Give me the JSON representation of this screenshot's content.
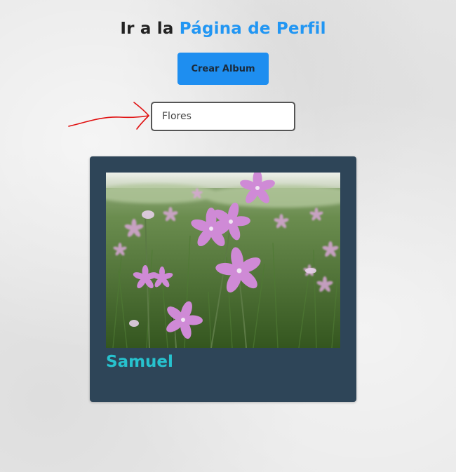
{
  "header": {
    "prefix": "Ir a la",
    "link_text": "Página de Perfil"
  },
  "actions": {
    "create_album_label": "Crear Album"
  },
  "search": {
    "value": "Flores"
  },
  "albums": [
    {
      "owner": "Samuel",
      "image_subject": "pink wildflowers in a green meadow"
    }
  ],
  "colors": {
    "accent": "#2196f3",
    "button": "#1e8ef0",
    "card_background": "#2e4558",
    "card_title": "#27c2ce",
    "annotation_arrow": "#e01010"
  },
  "icons": {
    "annotation": "red-arrow-icon"
  }
}
